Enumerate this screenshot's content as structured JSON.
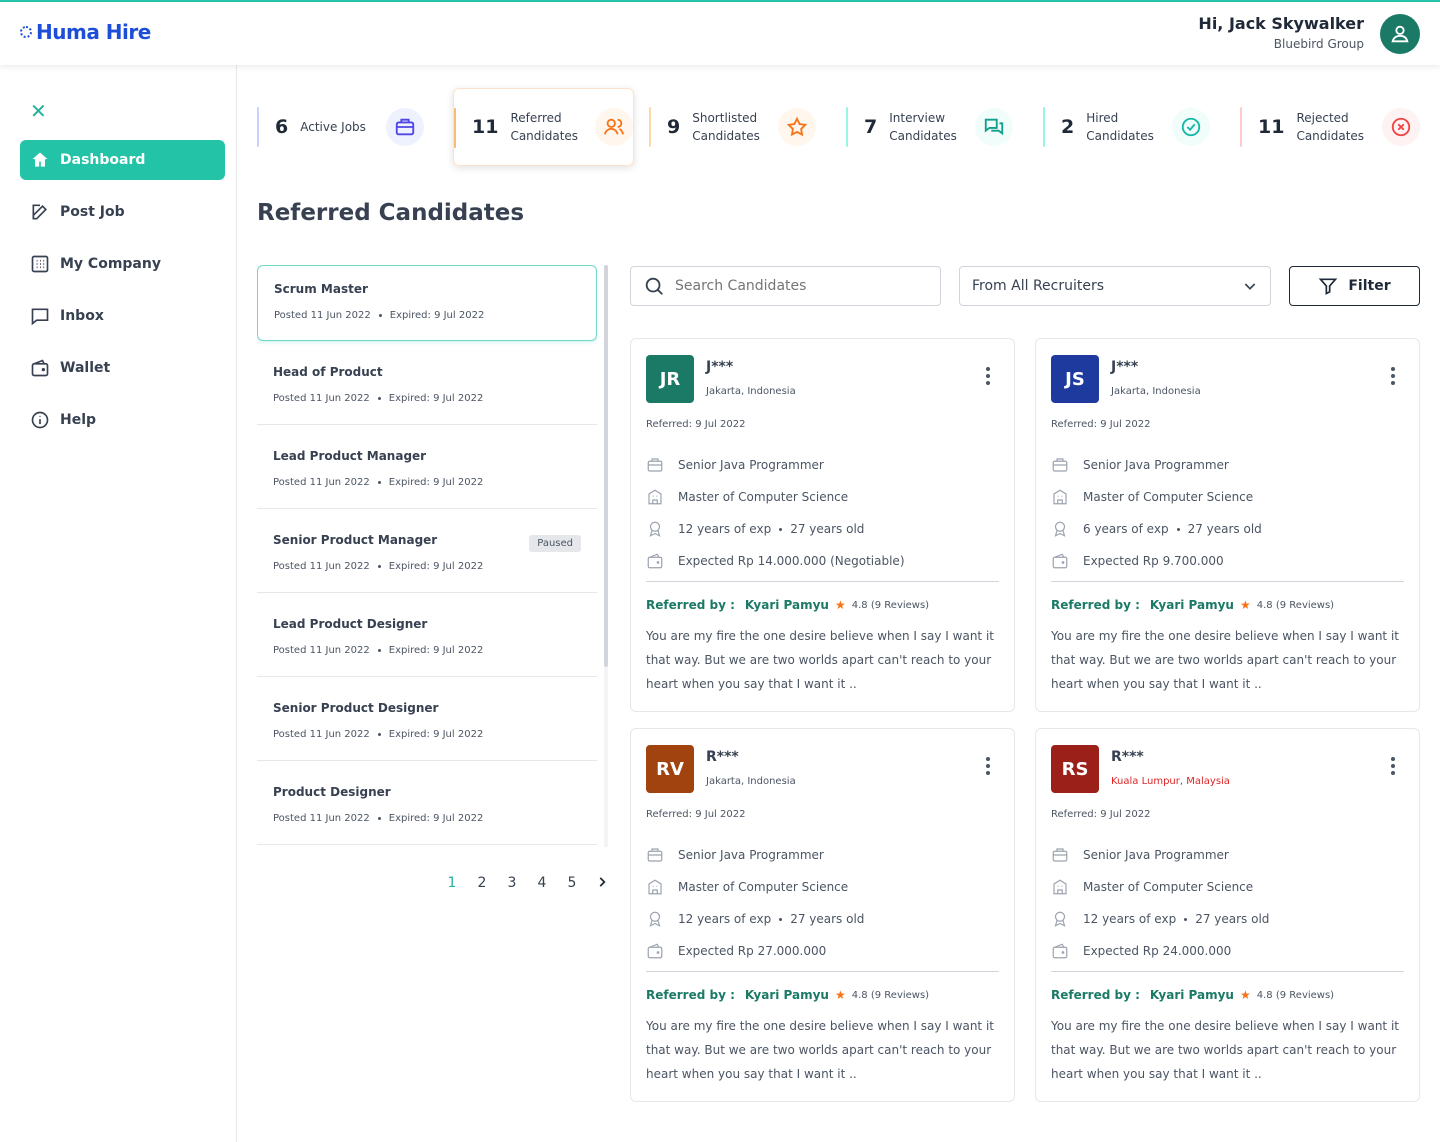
{
  "brand": {
    "logo_text": "Huma Hire",
    "accent": "#22c3a7"
  },
  "user": {
    "greeting": "Hi, Jack Skywalker",
    "company": "Bluebird Group"
  },
  "sidebar": {
    "items": [
      {
        "label": "Dashboard",
        "icon": "home-icon",
        "active": true
      },
      {
        "label": "Post Job",
        "icon": "edit-icon"
      },
      {
        "label": "My Company",
        "icon": "building-icon"
      },
      {
        "label": "Inbox",
        "icon": "chat-icon"
      },
      {
        "label": "Wallet",
        "icon": "wallet-icon"
      },
      {
        "label": "Help",
        "icon": "info-icon"
      }
    ]
  },
  "stats": [
    {
      "count": "6",
      "label": "Active Jobs",
      "icon": "briefcase-icon",
      "color": "#4f46e5"
    },
    {
      "count": "11",
      "label": "Referred Candidates",
      "icon": "users-icon",
      "color": "#f97316"
    },
    {
      "count": "9",
      "label": "Shortlisted Candidates",
      "icon": "star-icon",
      "color": "#f97316"
    },
    {
      "count": "7",
      "label": "Interview Candidates",
      "icon": "chat-icon",
      "color": "#14b8a6"
    },
    {
      "count": "2",
      "label": "Hired Candidates",
      "icon": "check-circle-icon",
      "color": "#14b8a6"
    },
    {
      "count": "11",
      "label": "Rejected Candidates",
      "icon": "x-circle-icon",
      "color": "#ef4444"
    }
  ],
  "page_title": "Referred Candidates",
  "jobs": [
    {
      "title": "Scrum Master",
      "posted": "Posted 11 Jun 2022",
      "expired": "Expired: 9 Jul 2022"
    },
    {
      "title": "Head of Product",
      "posted": "Posted 11 Jun 2022",
      "expired": "Expired: 9 Jul 2022"
    },
    {
      "title": "Lead Product Manager",
      "posted": "Posted 11 Jun 2022",
      "expired": "Expired: 9 Jul 2022"
    },
    {
      "title": "Senior Product Manager",
      "posted": "Posted 11 Jun 2022",
      "expired": "Expired: 9 Jul 2022",
      "badge": "Paused"
    },
    {
      "title": "Lead Product Designer",
      "posted": "Posted 11 Jun 2022",
      "expired": "Expired: 9 Jul 2022"
    },
    {
      "title": "Senior Product Designer",
      "posted": "Posted 11 Jun 2022",
      "expired": "Expired: 9 Jul 2022"
    },
    {
      "title": "Product Designer",
      "posted": "Posted 11 Jun 2022",
      "expired": "Expired: 9 Jul 2022"
    }
  ],
  "pagination": {
    "pages": [
      "1",
      "2",
      "3",
      "4",
      "5"
    ],
    "current": "1"
  },
  "search": {
    "placeholder": "Search Candidates"
  },
  "recruiter_select": {
    "value": "From All Recruiters"
  },
  "filter_label": "Filter",
  "candidates": [
    {
      "initials": "JR",
      "color": "#1b7a66",
      "name": "J***",
      "location": "Jakarta, Indonesia",
      "referred": "Referred: 9 Jul 2022",
      "position": "Senior Java Programmer",
      "education": "Master of Computer Science",
      "experience": "12 years of exp",
      "age": "27 years old",
      "salary": "Expected Rp 14.000.000 (Negotiable)",
      "referred_by_label": "Referred by :",
      "referrer": "Kyari Pamyu",
      "rating": "4.8",
      "reviews": "(9 Reviews)",
      "note": "You are my fire the one desire believe when I say I want it that way. But we are two worlds apart can't reach to your heart when you say that I want it .."
    },
    {
      "initials": "JS",
      "color": "#1e3a9f",
      "name": "J***",
      "location": "Jakarta, Indonesia",
      "referred": "Referred: 9 Jul 2022",
      "position": "Senior Java Programmer",
      "education": "Master of Computer Science",
      "experience": "6 years of exp",
      "age": "27 years old",
      "salary": "Expected Rp 9.700.000",
      "referred_by_label": "Referred by :",
      "referrer": "Kyari Pamyu",
      "rating": "4.8",
      "reviews": "(9 Reviews)",
      "note": "You are my fire the one desire believe when I say I want it that way. But we are two worlds apart can't reach to your heart when you say that I want it .."
    },
    {
      "initials": "RV",
      "color": "#a0430f",
      "name": "R***",
      "location": "Jakarta, Indonesia",
      "referred": "Referred: 9 Jul 2022",
      "position": "Senior Java Programmer",
      "education": "Master of Computer Science",
      "experience": "12 years of exp",
      "age": "27 years old",
      "salary": "Expected Rp 27.000.000",
      "referred_by_label": "Referred by :",
      "referrer": "Kyari Pamyu",
      "rating": "4.8",
      "reviews": "(9 Reviews)",
      "note": "You are my fire the one desire believe when I say I want it that way. But we are two worlds apart can't reach to your heart when you say that I want it .."
    },
    {
      "initials": "RS",
      "color": "#9b2019",
      "name": "R***",
      "location": "Kuala Lumpur, Malaysia",
      "location_red": true,
      "referred": "Referred: 9 Jul 2022",
      "position": "Senior Java Programmer",
      "education": "Master of Computer Science",
      "experience": "12 years of exp",
      "age": "27 years old",
      "salary": "Expected Rp 24.000.000",
      "referred_by_label": "Referred by :",
      "referrer": "Kyari Pamyu",
      "rating": "4.8",
      "reviews": "(9 Reviews)",
      "note": "You are my fire the one desire believe when I say I want it that way. But we are two worlds apart can't reach to your heart when you say that I want it .."
    }
  ]
}
